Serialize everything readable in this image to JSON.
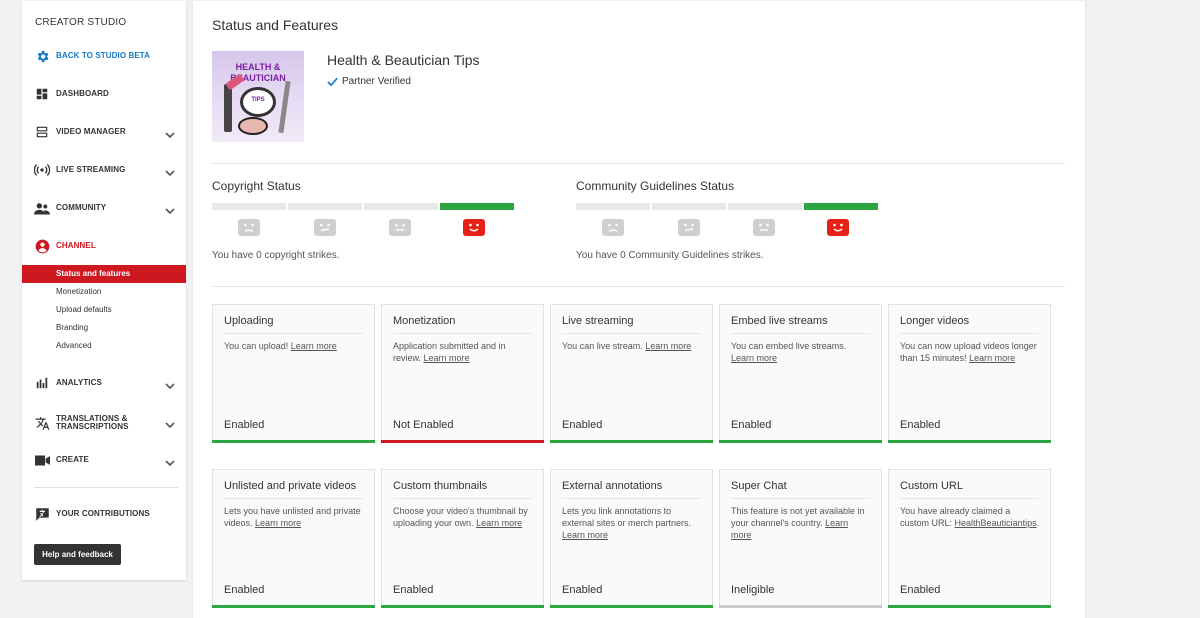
{
  "colors": {
    "accent_red": "#cc181e",
    "link_blue": "#167ac6",
    "enabled_green": "#2ba640",
    "disabled_red": "#cc181e",
    "neutral_grey": "#cccccc"
  },
  "sidebar": {
    "brand": "CREATOR STUDIO",
    "items": [
      {
        "label": "BACK TO STUDIO BETA",
        "icon": "gear-icon"
      },
      {
        "label": "DASHBOARD",
        "icon": "dashboard-icon"
      },
      {
        "label": "VIDEO MANAGER",
        "icon": "video-manager-icon"
      },
      {
        "label": "LIVE STREAMING",
        "icon": "live-icon"
      },
      {
        "label": "COMMUNITY",
        "icon": "community-icon"
      },
      {
        "label": "CHANNEL",
        "icon": "channel-icon"
      },
      {
        "label": "ANALYTICS",
        "icon": "analytics-icon"
      },
      {
        "label": "TRANSLATIONS & TRANSCRIPTIONS",
        "icon": "translate-icon"
      },
      {
        "label": "CREATE",
        "icon": "camera-icon"
      },
      {
        "label": "YOUR CONTRIBUTIONS",
        "icon": "contributions-icon"
      }
    ],
    "channel_sub": [
      "Status and features",
      "Monetization",
      "Upload defaults",
      "Branding",
      "Advanced"
    ],
    "help_button": "Help and feedback"
  },
  "main": {
    "title": "Status and Features",
    "channel": {
      "name": "Health & Beautician Tips",
      "verified": "Partner Verified",
      "thumb_text_1": "HEALTH &",
      "thumb_text_2": "BEAUTICIAN",
      "thumb_text_3": "TIPS"
    },
    "copyright": {
      "title": "Copyright Status",
      "text": "You have 0 copyright strikes.",
      "active_segment": 4
    },
    "community": {
      "title": "Community Guidelines Status",
      "text": "You have 0 Community Guidelines strikes.",
      "active_segment": 4
    },
    "features": [
      {
        "title": "Uploading",
        "desc": "You can upload!",
        "link": "Learn more",
        "state": "Enabled",
        "status": "enabled"
      },
      {
        "title": "Monetization",
        "desc": "Application submitted and in review.",
        "link": "Learn more",
        "state": "Not Enabled",
        "status": "disabled"
      },
      {
        "title": "Live streaming",
        "desc": "You can live stream.",
        "link": "Learn more",
        "state": "Enabled",
        "status": "enabled"
      },
      {
        "title": "Embed live streams",
        "desc": "You can embed live streams.",
        "link": "Learn more",
        "state": "Enabled",
        "status": "enabled"
      },
      {
        "title": "Longer videos",
        "desc": "You can now upload videos longer than 15 minutes!",
        "link": "Learn more",
        "state": "Enabled",
        "status": "enabled"
      },
      {
        "title": "Unlisted and private videos",
        "desc": "Lets you have unlisted and private videos.",
        "link": "Learn more",
        "state": "Enabled",
        "status": "enabled"
      },
      {
        "title": "Custom thumbnails",
        "desc": "Choose your video's thumbnail by uploading your own.",
        "link": "Learn more",
        "state": "Enabled",
        "status": "enabled"
      },
      {
        "title": "External annotations",
        "desc": "Lets you link annotations to external sites or merch partners.",
        "link": "Learn more",
        "state": "Enabled",
        "status": "enabled"
      },
      {
        "title": "Super Chat",
        "desc": "This feature is not yet available in your channel's country.",
        "link": "Learn more",
        "state": "Ineligible",
        "status": "ineligible"
      },
      {
        "title": "Custom URL",
        "desc": "You have already claimed a custom URL:",
        "link": "HealthBeauticiantips",
        "state": "Enabled",
        "status": "enabled"
      }
    ]
  }
}
